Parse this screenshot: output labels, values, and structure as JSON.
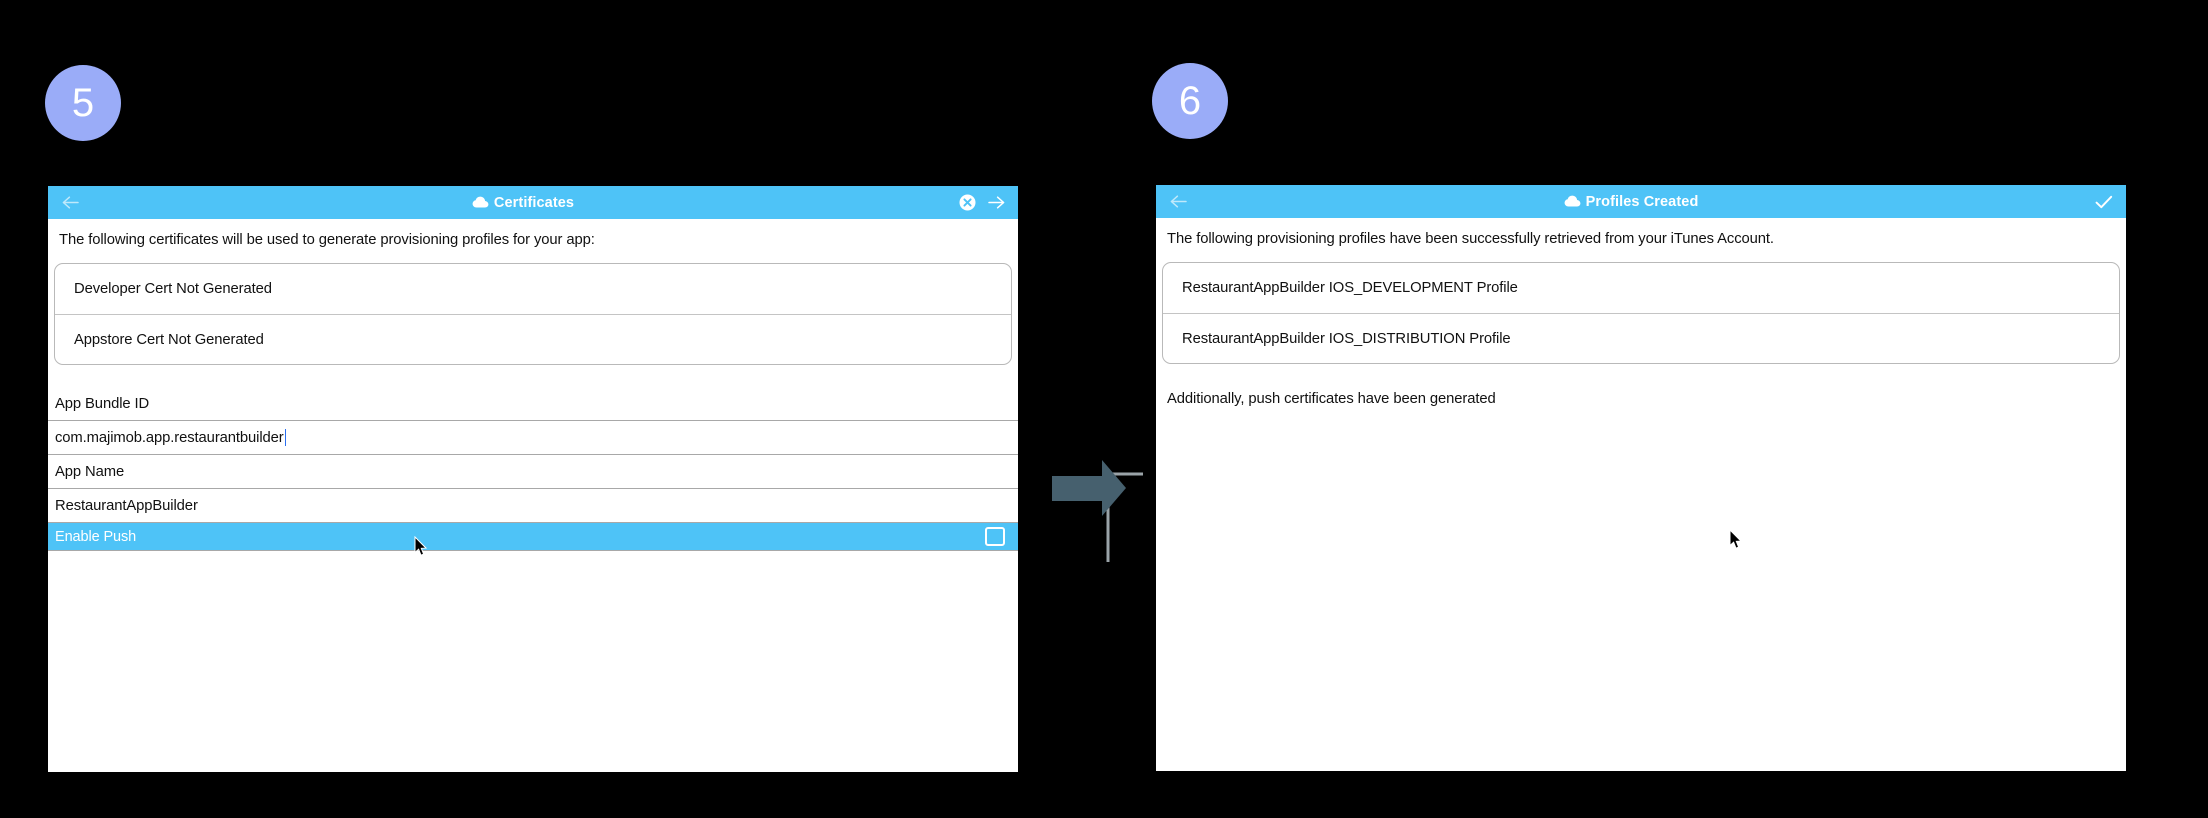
{
  "steps": [
    {
      "number": "5"
    },
    {
      "number": "6"
    }
  ],
  "colors": {
    "badge": "#9aacf8",
    "titlebar": "#4ec3f7",
    "highlight_row": "#4ec3f7",
    "page_background": "#000000",
    "panel_background": "#ffffff",
    "connector_arrow": "#46606e",
    "connector_line": "#9aa3a8",
    "caret": "#2a6ff0"
  },
  "panels": {
    "certificates": {
      "titlebar": {
        "back_icon": "arrow-left-icon",
        "cloud_icon": "cloud-icon",
        "title": "Certificates",
        "close_icon": "close-circle-icon",
        "forward_icon": "arrow-right-icon"
      },
      "intro": "The following certificates will be used to generate provisioning profiles for your app:",
      "cert_list": [
        "Developer Cert Not Generated",
        "Appstore Cert Not Generated"
      ],
      "fields": [
        {
          "label": "App Bundle ID",
          "value": "com.majimob.app.restaurantbuilder",
          "has_caret": true
        },
        {
          "label": "App Name",
          "value": "RestaurantAppBuilder",
          "has_caret": false
        }
      ],
      "toggle_row": {
        "label": "Enable Push",
        "checkbox_icon": "checkbox-unchecked-icon",
        "checked": false
      }
    },
    "profiles": {
      "titlebar": {
        "back_icon": "arrow-left-icon",
        "cloud_icon": "cloud-icon",
        "title": "Profiles Created",
        "confirm_icon": "check-icon"
      },
      "intro": "The following provisioning profiles have been successfully retrieved from your iTunes Account.",
      "profile_list": [
        "RestaurantAppBuilder IOS_DEVELOPMENT Profile",
        "RestaurantAppBuilder IOS_DISTRIBUTION Profile"
      ],
      "note": "Additionally, push certificates have been generated"
    }
  }
}
